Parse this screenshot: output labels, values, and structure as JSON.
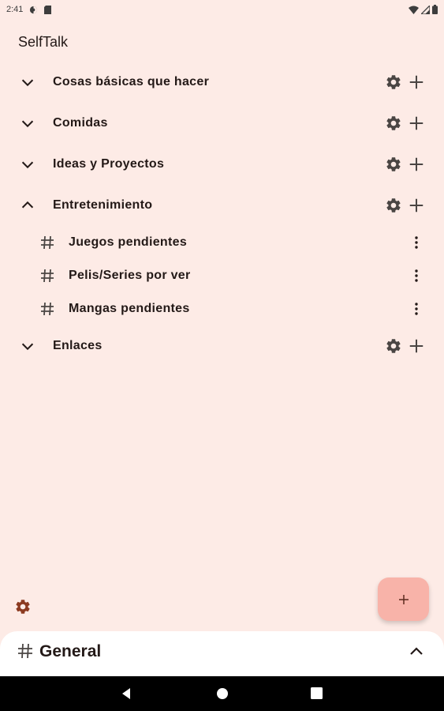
{
  "status_bar": {
    "time": "2:41"
  },
  "app": {
    "title": "SelfTalk"
  },
  "categories": [
    {
      "label": "Cosas básicas que hacer",
      "expanded": false
    },
    {
      "label": "Comidas",
      "expanded": false
    },
    {
      "label": "Ideas y Proyectos",
      "expanded": false
    },
    {
      "label": "Entretenimiento",
      "expanded": true,
      "channels": [
        {
          "label": "Juegos pendientes"
        },
        {
          "label": "Pelis/Series por ver"
        },
        {
          "label": "Mangas pendientes"
        }
      ]
    },
    {
      "label": "Enlaces",
      "expanded": false
    }
  ],
  "fab": {
    "icon": "plus-icon"
  },
  "bottom_sheet": {
    "title": "General",
    "icon": "hash-icon"
  },
  "colors": {
    "background": "#fdebe6",
    "accent": "#8c3a20",
    "fab": "#f8b3a9",
    "icon": "#4a4543",
    "text": "#231917"
  }
}
